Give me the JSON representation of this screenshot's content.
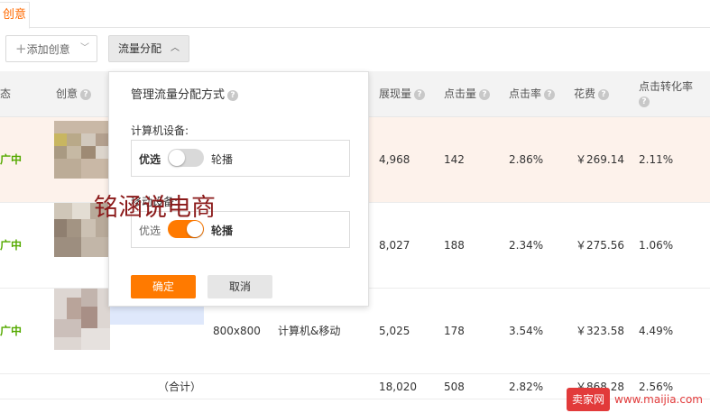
{
  "tabs": {
    "active_label": "创意"
  },
  "toolbar": {
    "add_label": "添加创意",
    "flow_label": "流量分配"
  },
  "table": {
    "headers": {
      "status": "态",
      "creative": "创意",
      "impressions": "展现量",
      "clicks": "点击量",
      "ctr": "点击率",
      "cost": "花费",
      "cvr": "点击转化率"
    },
    "rows": [
      {
        "status": "广中",
        "impressions": "4,968",
        "clicks": "142",
        "ctr": "2.86%",
        "cost": "￥269.14",
        "cvr": "2.11%"
      },
      {
        "status": "广中",
        "impressions": "8,027",
        "clicks": "188",
        "ctr": "2.34%",
        "cost": "￥275.56",
        "cvr": "1.06%"
      },
      {
        "status": "广中",
        "size": "800x800",
        "device": "计算机&移动",
        "impressions": "5,025",
        "clicks": "178",
        "ctr": "3.54%",
        "cost": "￥323.58",
        "cvr": "4.49%"
      }
    ],
    "total": {
      "label": "（合计）",
      "impressions": "18,020",
      "clicks": "508",
      "ctr": "2.82%",
      "cost": "￥868.28",
      "cvr": "2.56%"
    }
  },
  "popup": {
    "title": "管理流量分配方式",
    "computer_label": "计算机设备:",
    "mobile_label": "移动设备:",
    "optimize": "优选",
    "rotate": "轮播",
    "computer_on": false,
    "mobile_on": true,
    "ok_label": "确定",
    "cancel_label": "取消"
  },
  "watermark": {
    "text": "铭涵说电商",
    "site_logo": "卖家网",
    "site_url": "www.maijia.com"
  },
  "colors": {
    "accent": "#ff7a00",
    "status_green": "#55aa00",
    "highlight_row": "#fdf2eb"
  }
}
